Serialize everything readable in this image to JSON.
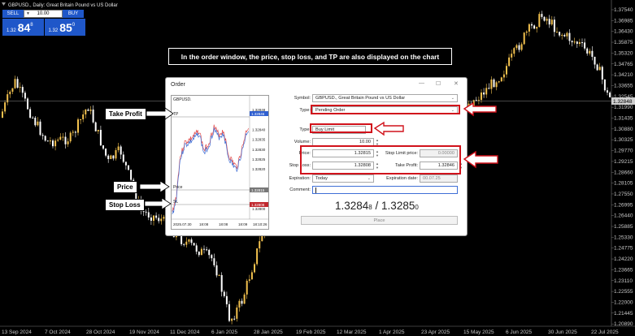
{
  "chart": {
    "title": "GBPUSD., Daily:  Great Britain Pound vs US Dollar",
    "price_ticks": [
      "1.37540",
      "1.36985",
      "1.36430",
      "1.35875",
      "1.35320",
      "1.34765",
      "1.34210",
      "1.33655",
      "1.32545",
      "1.31990",
      "1.31435",
      "1.30880",
      "1.30325",
      "1.29770",
      "1.29215",
      "1.28660",
      "1.28105",
      "1.27550",
      "1.26995",
      "1.26440",
      "1.25885",
      "1.25330",
      "1.24775",
      "1.24220",
      "1.23665",
      "1.23110",
      "1.22555",
      "1.22000",
      "1.21445",
      "1.20890"
    ],
    "current_price": "1.32848",
    "date_ticks": [
      "13 Sep 2024",
      "7 Oct 2024",
      "28 Oct 2024",
      "19 Nov 2024",
      "11 Dec 2024",
      "6 Jan 2025",
      "28 Jan 2025",
      "19 Feb 2025",
      "12 Mar 2025",
      "1 Apr 2025",
      "23 Apr 2025",
      "15 May 2025",
      "6 Jun 2025",
      "30 Jun 2025",
      "22 Jul 2025"
    ],
    "colors": {
      "bull": "#f2c14e",
      "bear": "#ffffff",
      "background": "#000000",
      "grid": "#262626"
    }
  },
  "one_click": {
    "sell_label": "SELL",
    "buy_label": "BUY",
    "lot": "10.00",
    "sell_small": "1.32",
    "sell_big": "84",
    "sell_sup": "8",
    "buy_small": "1.32",
    "buy_big": "85",
    "buy_sup": "0"
  },
  "headline": "In the order window, the price, stop loss, and TP are also displayed on the chart",
  "annotations": {
    "take_profit": "Take Profit",
    "price": "Price",
    "stop_loss": "Stop Loss"
  },
  "dialog": {
    "title": "Order",
    "min_icon": "minimize-icon",
    "max_icon": "maximize-icon",
    "close_icon": "close-icon",
    "mini_chart": {
      "symbol": "GBPUSD.",
      "tp_label": "TP",
      "price_label": "Price",
      "sl_label": "SL",
      "ticks": [
        "1.32848",
        "1.32846",
        "1.32840",
        "1.32835",
        "1.32830",
        "1.32825",
        "1.32820",
        "1.32815",
        "1.32810",
        "1.32805",
        "1.32800"
      ],
      "tp_badge": "1.32846",
      "sl_badge": "1.32808",
      "price_badge": "1.32815",
      "time_labels": [
        "2025.07.30",
        "18:08",
        "18:08",
        "18:09",
        "18:10:26"
      ]
    },
    "symbol_label": "Symbol:",
    "symbol_value": "GBPUSD., Great Britain Pound vs US Dollar",
    "type_label": "Type:",
    "type_value": "Pending Order",
    "order_type_label": "Type:",
    "order_type_value": "Buy Limit",
    "volume_label": "Volume:",
    "volume_value": "10.00",
    "price_label": "Price:",
    "price_value": "1.32815",
    "stop_limit_label": "Stop Limit price:",
    "stop_limit_value": "0.00000",
    "stop_loss_label": "Stop Loss:",
    "stop_loss_value": "1.32808",
    "take_profit_label": "Take Profit:",
    "take_profit_value": "1.32846",
    "expiration_label": "Expiration:",
    "expiration_value": "Today",
    "expiration_date_label": "Expiration date:",
    "expiration_date_value": "00.07.25",
    "comment_label": "Comment:",
    "comment_value": "",
    "bid_main": "1.3284",
    "bid_small": "8",
    "separator": "/",
    "ask_main": "1.3285",
    "ask_small": "0",
    "place_label": "Place"
  }
}
